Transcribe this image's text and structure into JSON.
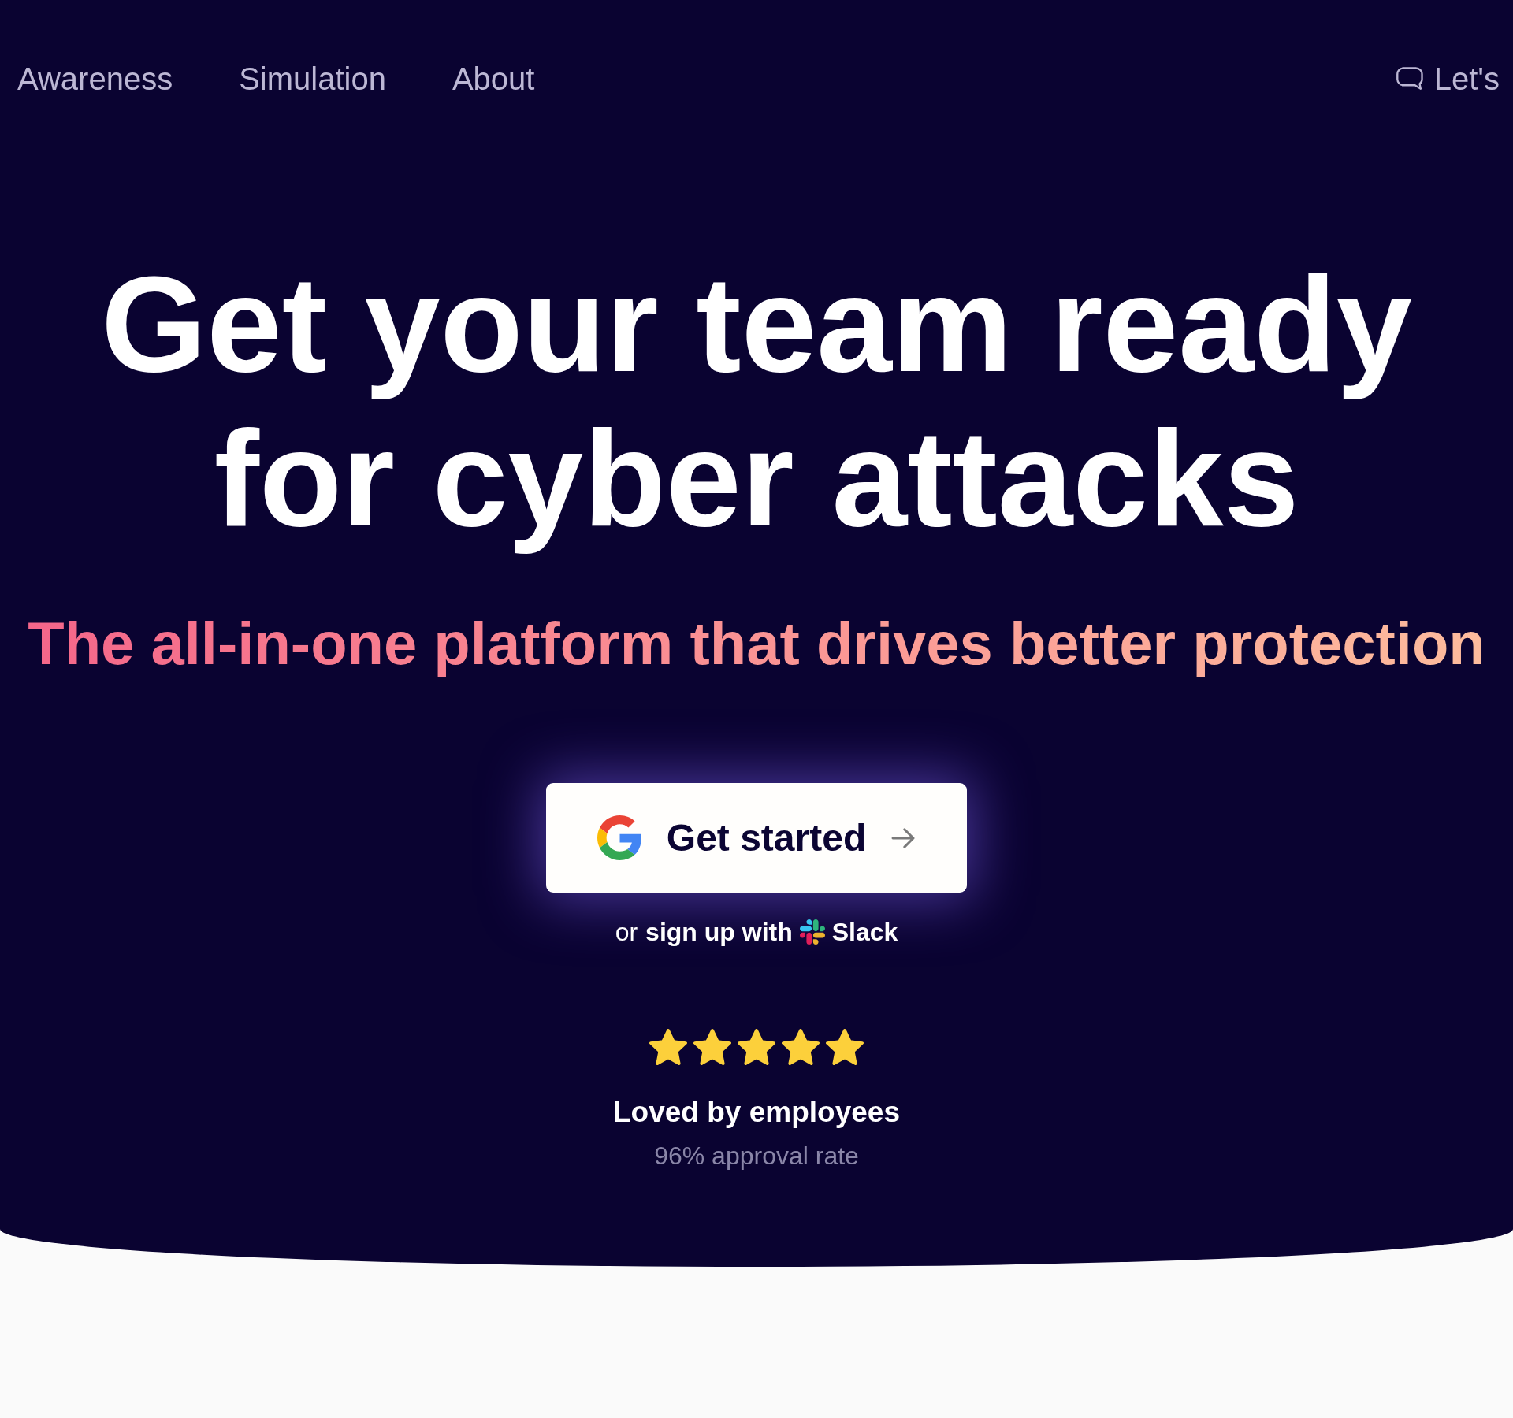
{
  "nav": {
    "links": [
      "Awareness",
      "Simulation",
      "About"
    ],
    "contact": {
      "label": "Let's"
    }
  },
  "hero": {
    "title": "Get your team ready for cyber attacks",
    "subtitle": "The all-in-one platform that drives better protection",
    "cta": {
      "label": "Get started"
    },
    "alt_signup": {
      "prefix": "or",
      "link": "sign up with",
      "brand": "Slack"
    },
    "rating": {
      "stars": 5,
      "title": "Loved by employees",
      "caption": "96% approval rate"
    }
  }
}
